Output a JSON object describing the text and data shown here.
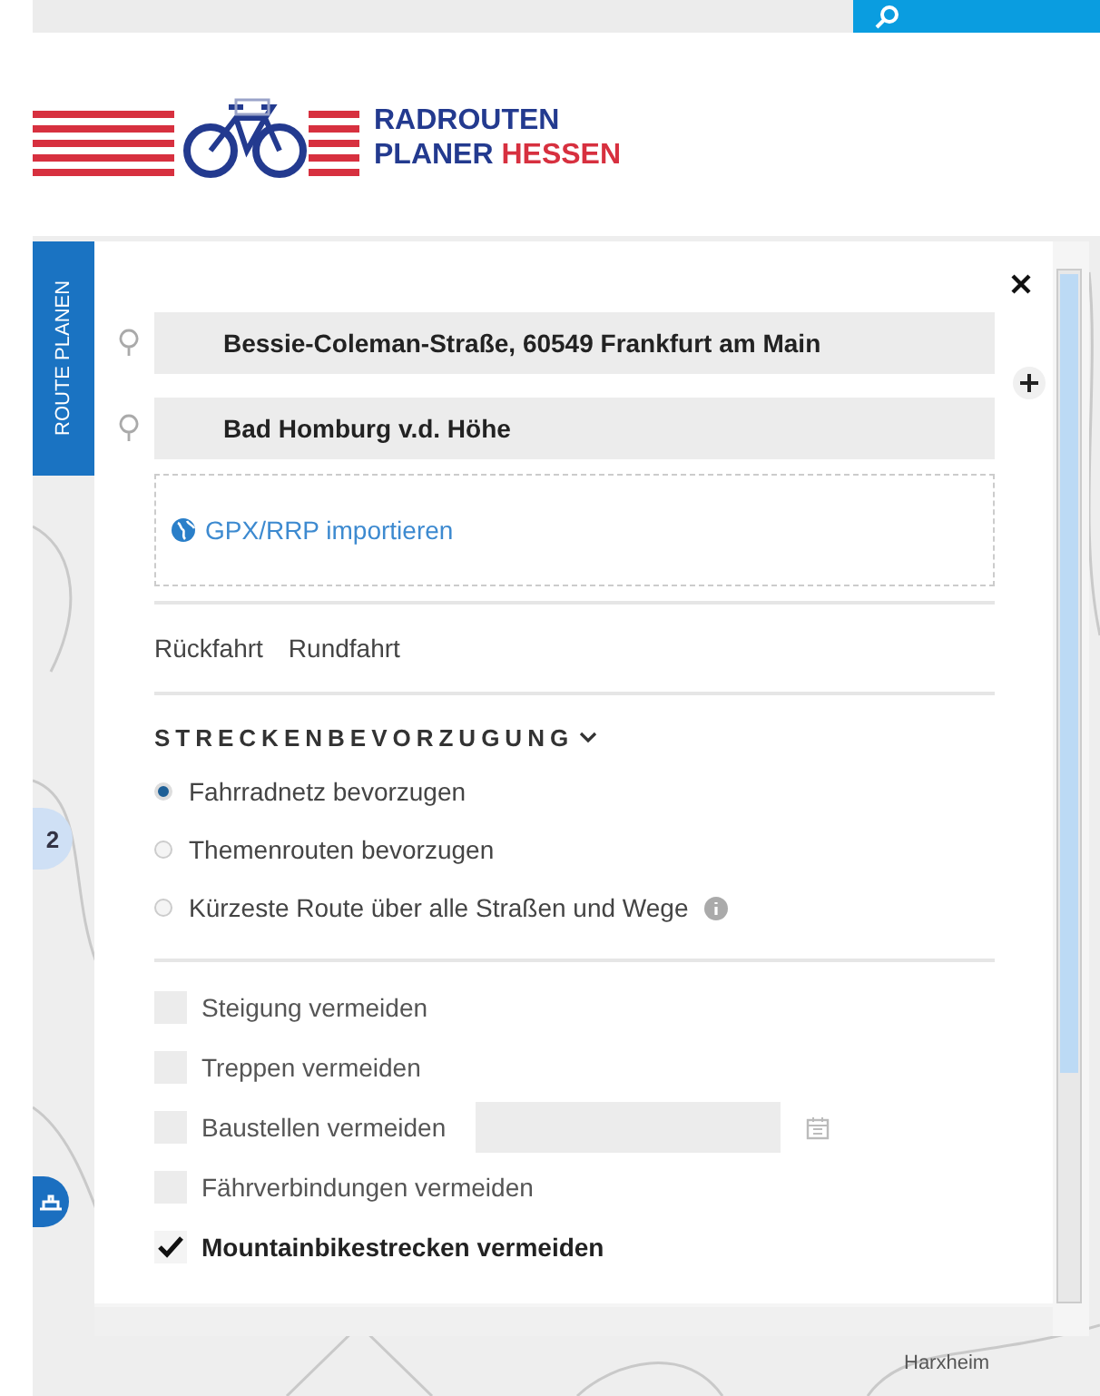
{
  "logo": {
    "line1": "RADROUTEN",
    "line2": "PLANER",
    "line2_accent": "HESSEN"
  },
  "side_tab": {
    "label": "ROUTE PLANEN",
    "selected": true
  },
  "waypoints": [
    {
      "value": "Bessie-Coleman-Straße, 60549 Frankfurt am Main"
    },
    {
      "value": "Bad Homburg v.d. Höhe"
    }
  ],
  "import": {
    "label": "GPX/RRP importieren"
  },
  "trip_options": [
    "Rückfahrt",
    "Rundfahrt"
  ],
  "section": {
    "title": "STRECKENBEVORZUGUNG"
  },
  "preferences": [
    {
      "label": "Fahrradnetz bevorzugen",
      "selected": true,
      "info": false
    },
    {
      "label": "Themenrouten bevorzugen",
      "selected": false,
      "info": false
    },
    {
      "label": "Kürzeste Route über alle Straßen und Wege",
      "selected": false,
      "info": true
    }
  ],
  "avoid": [
    {
      "kind": "plain",
      "label": "Steigung vermeiden",
      "checked": false
    },
    {
      "kind": "plain",
      "label": "Treppen vermeiden",
      "checked": false
    },
    {
      "kind": "date",
      "label": "Baustellen vermeiden",
      "checked": false
    },
    {
      "kind": "plain",
      "label": "Fährverbindungen vermeiden",
      "checked": false
    },
    {
      "kind": "plain",
      "label": "Mountainbikestrecken vermeiden",
      "checked": true
    }
  ],
  "map": {
    "cluster": "2",
    "place": "Harxheim"
  }
}
